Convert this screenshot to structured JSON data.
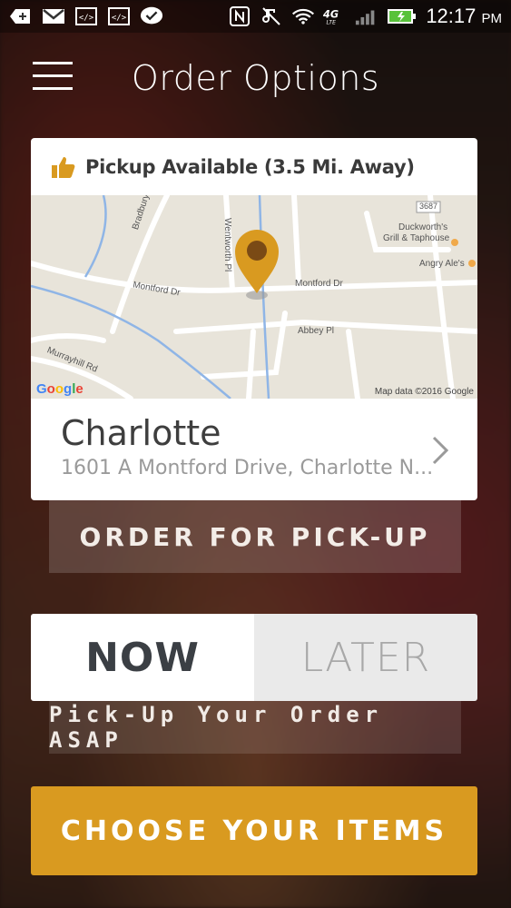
{
  "status_bar": {
    "time": "12:17",
    "ampm": "PM",
    "network": "4G LTE",
    "icons": [
      "add-icon",
      "gmail-icon",
      "code-icon",
      "code-icon",
      "check-bubble-icon",
      "nfc-icon",
      "silent-icon",
      "wifi-icon",
      "signal-icon",
      "battery-icon"
    ]
  },
  "header": {
    "title": "Order Options",
    "menu_icon": "hamburger-menu-icon"
  },
  "location_card": {
    "availability": "Pickup Available (3.5 Mi. Away)",
    "map": {
      "labels": {
        "bradbury": "Bradbury Dr",
        "wentworth": "Wentworth Pl",
        "montford_left": "Montford Dr",
        "montford_right": "Montford Dr",
        "abbey": "Abbey Pl",
        "murrayhill": "Murrayhill Rd",
        "route": "3687",
        "duckworth_1": "Duckworth's",
        "duckworth_2": "Grill & Taphouse",
        "angry_ales": "Angry Ale's"
      },
      "attribution": "Map data ©2016 Google",
      "google": [
        "G",
        "o",
        "o",
        "g",
        "l",
        "e"
      ]
    },
    "name": "Charlotte",
    "address": "1601 A Montford Drive, Charlotte N..."
  },
  "order_type_label": "ORDER FOR PICK-UP",
  "timing": {
    "options": [
      "NOW",
      "LATER"
    ],
    "selected": "NOW",
    "description": "Pick-Up Your Order ASAP"
  },
  "cta_label": "CHOOSE YOUR ITEMS",
  "colors": {
    "accent": "#D99A20",
    "pin": "#D99A20",
    "card_bg": "#FFFFFF"
  }
}
